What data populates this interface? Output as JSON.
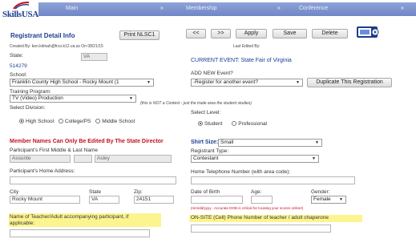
{
  "header": {
    "logo_text": "SkillsUSA",
    "nav": [
      "Main",
      "Membership",
      "Conference"
    ]
  },
  "toolbar": {
    "title": "Registrant Detail Info",
    "print_label": "Print NLSC1",
    "prev_label": "<<",
    "next_label": ">>",
    "apply_label": "Apply",
    "save_label": "Save",
    "delete_label": "Delete",
    "video_icon": "watch-video-icon"
  },
  "meta": {
    "created_by": "Created By: ken.kilmah@frco.k12.va.us On 08/21/15",
    "last_edited": "Last Edited By:"
  },
  "left": {
    "state_label": "State:",
    "state_value": "VA",
    "id_value": "514279",
    "school_label": "School:",
    "school_value": "Franklin County High School - Rocky Mount (1",
    "program_label": "Training Program:",
    "program_value": "TV (Video) Production",
    "division_label": "Select Division:",
    "divisions": [
      "High School",
      "College/PS",
      "Middle School"
    ],
    "division_selected": 0,
    "warning": "Member Names Can Only Be Edited By The State Director",
    "name_label": "Participant's First Middle & Last Name",
    "first_name": "Assunte",
    "middle_name": "",
    "last_name": "Asley",
    "address_label": "Participant's Home Address:",
    "address_value": "",
    "city_label": "City",
    "city_value": "Rocky Mount",
    "state2_label": "State",
    "state2_value": "VA",
    "zip_label": "Zip:",
    "zip_value": "24151",
    "teacher_label_1": "Name of Teacher/Adult accompanying participant, if",
    "teacher_label_2": "applicable:",
    "teacher_value": ""
  },
  "right": {
    "current_event": "CURRENT EVENT: State Fair of Virginia",
    "add_event_label": "ADD NEW Event?",
    "add_event_value": "-Register for another event?",
    "duplicate_label": "Duplicate This Registration",
    "contest_note": "(this is NOT a Contest - just the trade area the student studies)",
    "level_label": "Select Level:",
    "levels": [
      "Student",
      "Professional"
    ],
    "level_selected": 0,
    "shirt_label": "Shirt Size:",
    "shirt_value": "Small",
    "type_label": "Registrant Type:",
    "type_value": "Contestant",
    "phone_label": "Home Telephone Number (with area code):",
    "phone_value": "",
    "dob_label": "Date of Birth",
    "dob_value": "",
    "age_label": "Age:",
    "age_value": "",
    "gender_label": "Gender:",
    "gender_value": "Female",
    "dob_note": "(mm/dd/yyyy - Accurate DOB is critical for locating your scores online!)",
    "onsite_label": "ON-SITE (Cell) Phone Number of teacher / adult chaperone",
    "onsite_value": ""
  },
  "colors": {
    "nav": "#7a90cc",
    "brand": "#1a3f8f",
    "warning": "#c1121f",
    "highlight": "#fcf48f"
  }
}
